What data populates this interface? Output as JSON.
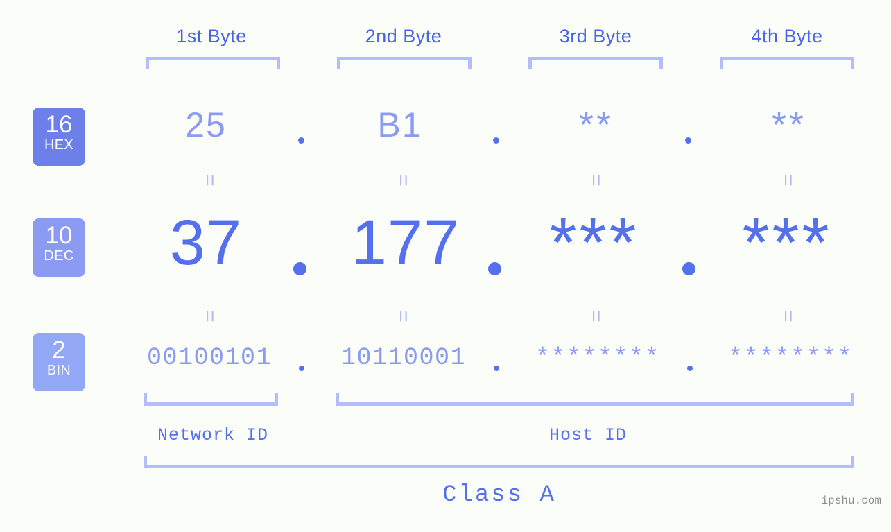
{
  "meta": {
    "background_color": "#fbfdf8",
    "accent_strong": "#5570ec",
    "accent_mid": "#8b9bf2",
    "accent_light": "#b3bdfb",
    "watermark": "ipshu.com"
  },
  "byte_headers": [
    {
      "label": "1st Byte"
    },
    {
      "label": "2nd Byte"
    },
    {
      "label": "3rd Byte"
    },
    {
      "label": "4th Byte"
    }
  ],
  "rows": [
    {
      "badge_number": "16",
      "badge_name": "HEX",
      "badge_color": "#6d80e9",
      "values": [
        "25",
        "B1",
        "**",
        "**"
      ]
    },
    {
      "badge_number": "10",
      "badge_name": "DEC",
      "badge_color": "#8b9bf2",
      "values": [
        "37",
        "177",
        "***",
        "***"
      ]
    },
    {
      "badge_number": "2",
      "badge_name": "BIN",
      "badge_color": "#93a7f7",
      "values": [
        "00100101",
        "10110001",
        "********",
        "********"
      ]
    }
  ],
  "separators": {
    "dot": ".",
    "equals": "="
  },
  "id_sections": [
    {
      "label": "Network ID"
    },
    {
      "label": "Host ID"
    }
  ],
  "class_label": "Class A"
}
